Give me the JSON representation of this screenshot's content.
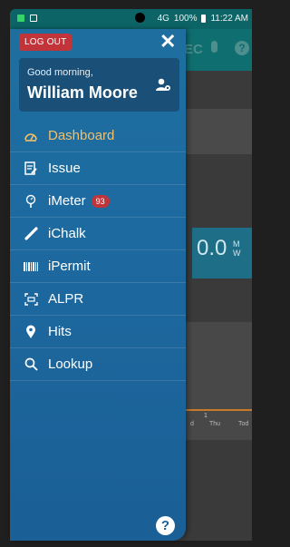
{
  "status_bar": {
    "battery": "100%",
    "time": "11:22 AM",
    "signal": "4G"
  },
  "drawer": {
    "logout_label": "LOG OUT",
    "close_icon": "close-icon",
    "greeting": "Good morning,",
    "user_name": "William Moore",
    "menu": [
      {
        "label": "Dashboard",
        "icon": "dashboard-icon",
        "active": true
      },
      {
        "label": "Issue",
        "icon": "issue-icon"
      },
      {
        "label": "iMeter",
        "icon": "imeter-icon",
        "badge": "93"
      },
      {
        "label": "iChalk",
        "icon": "chalk-icon"
      },
      {
        "label": "iPermit",
        "icon": "barcode-icon"
      },
      {
        "label": "ALPR",
        "icon": "plate-scan-icon"
      },
      {
        "label": "Hits",
        "icon": "location-pin-icon"
      },
      {
        "label": "Lookup",
        "icon": "search-icon"
      }
    ],
    "help_label": "?"
  },
  "background": {
    "header_partial": "EC",
    "help_label": "?",
    "meter_value": "0.0",
    "meter_unit_partial": "M\nW",
    "chart_point_label": "1",
    "chart_days": [
      "d",
      "Thu",
      "Tod"
    ]
  },
  "colors": {
    "drawer": "#1e6fa0",
    "active": "#f2c06b",
    "badge": "#c0343a",
    "logout": "#c0343a",
    "teal": "#0f6e6f"
  }
}
